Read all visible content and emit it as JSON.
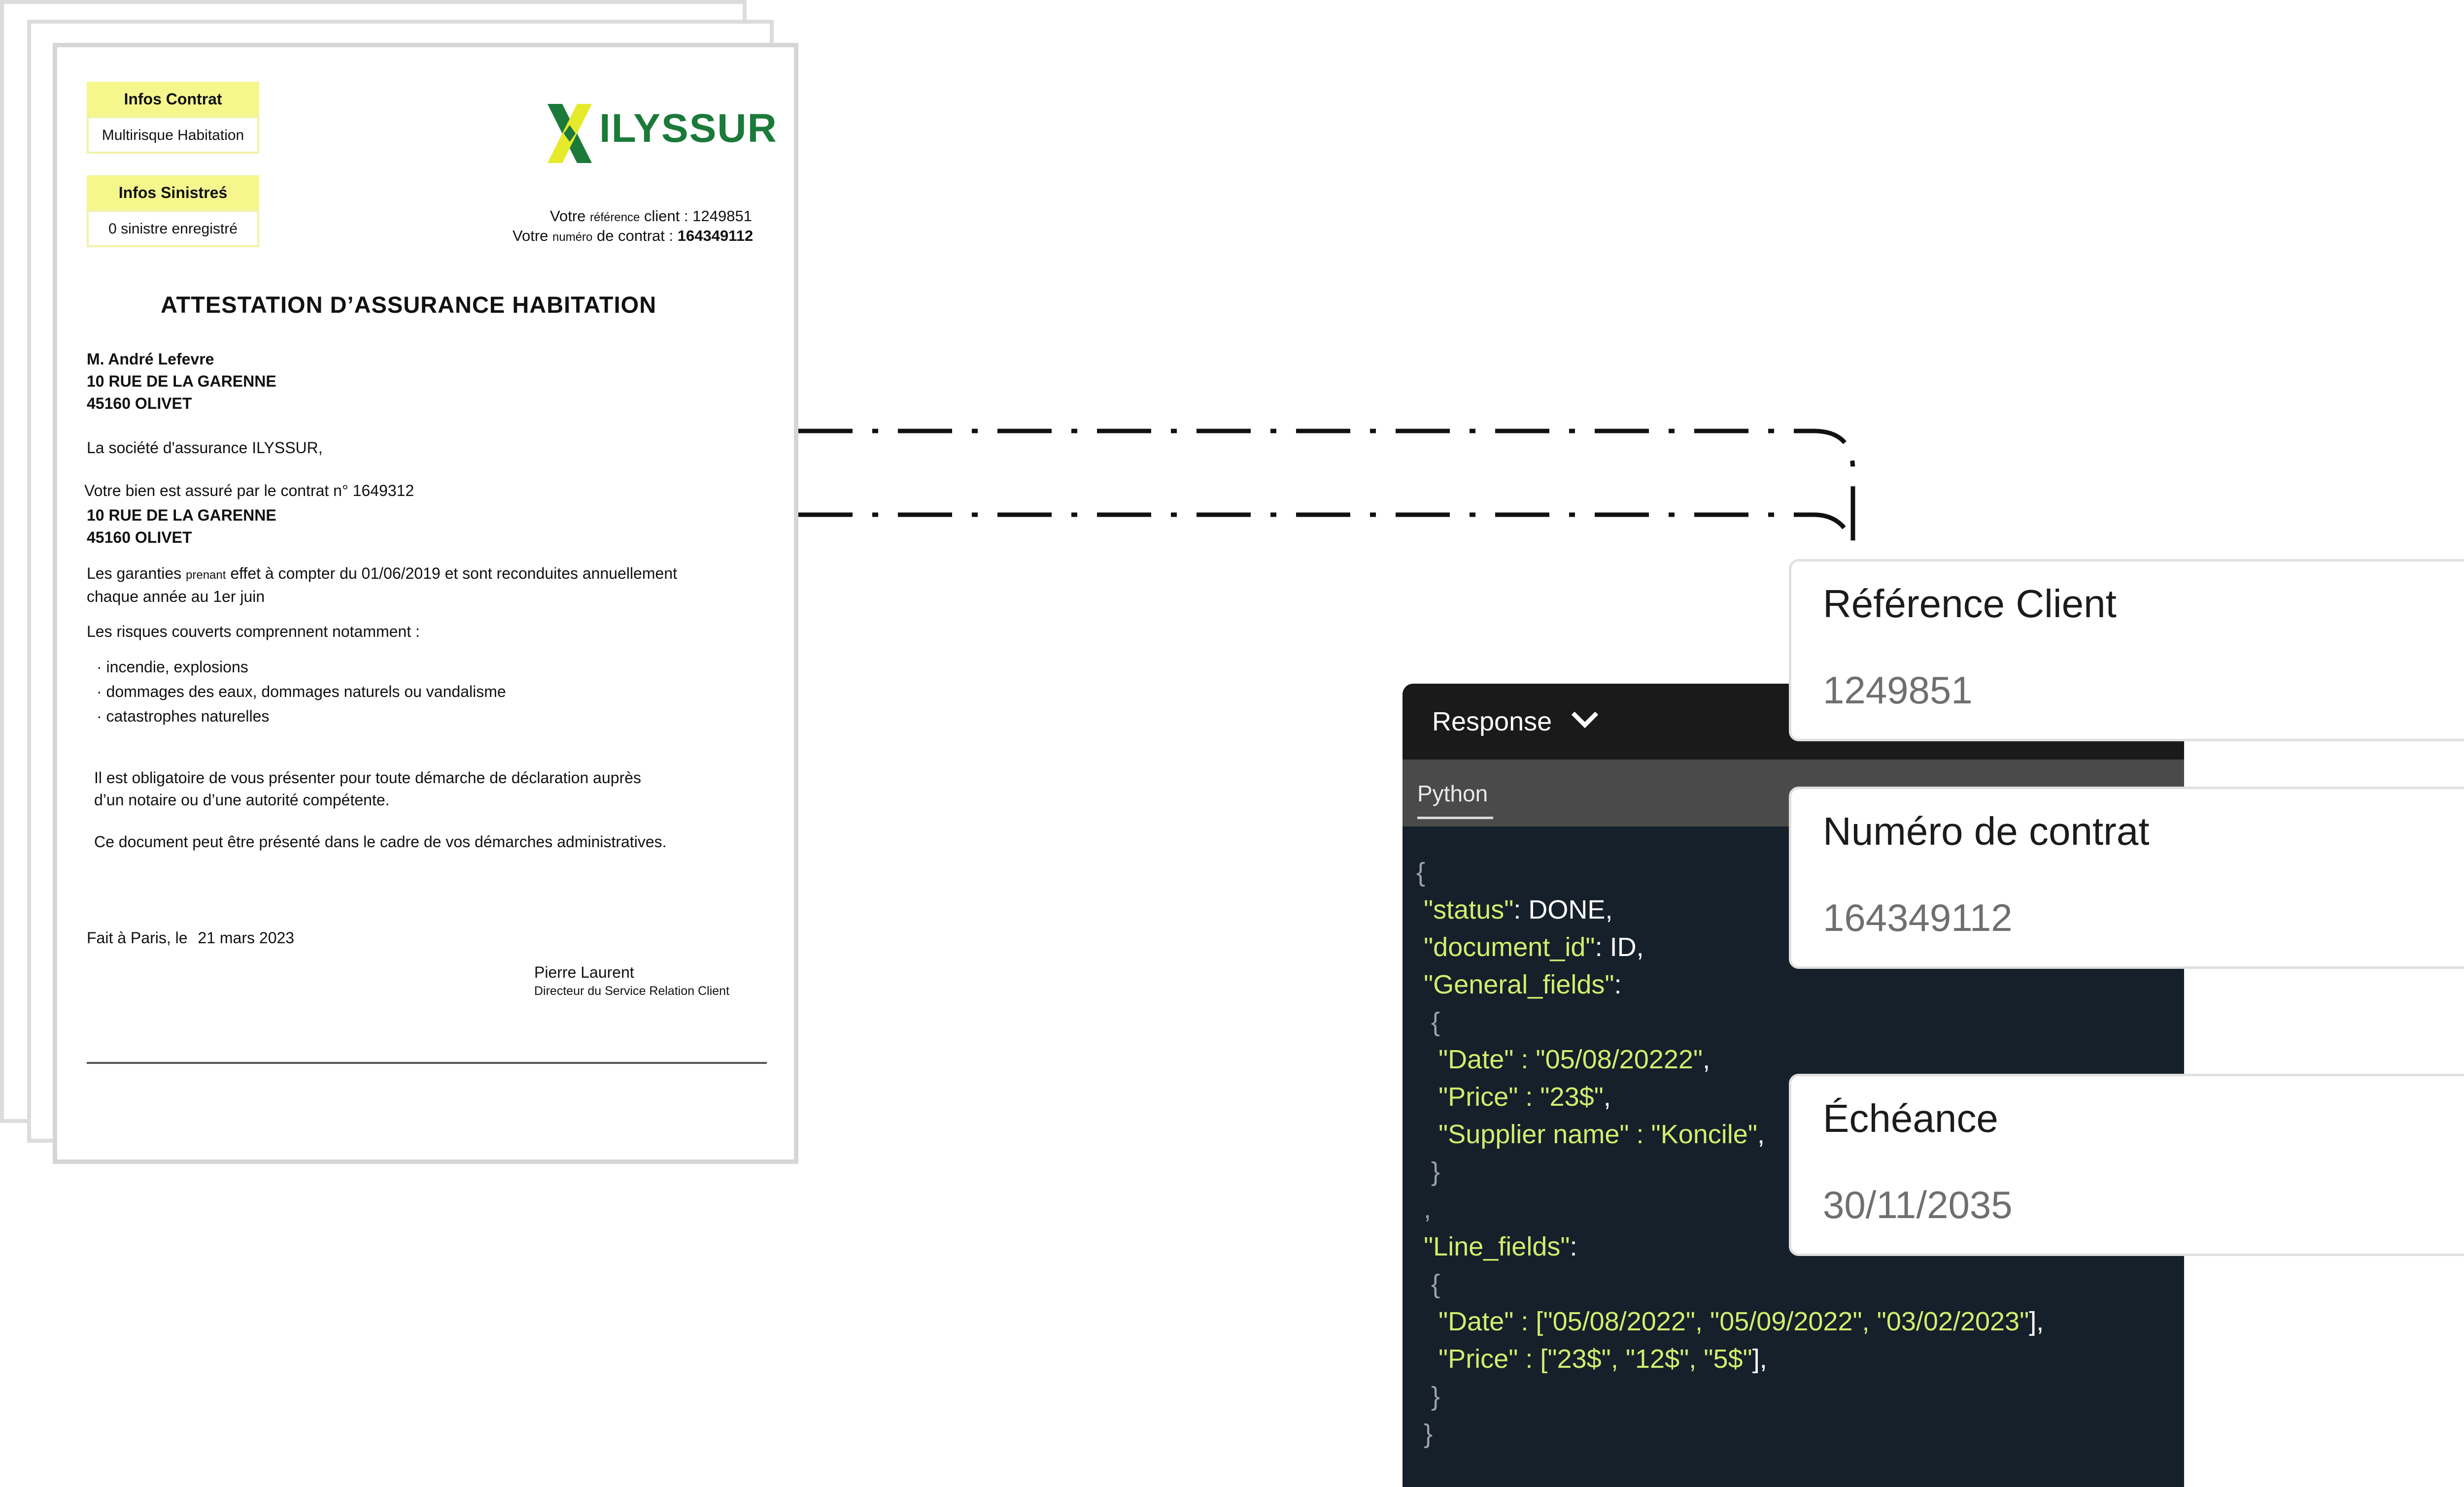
{
  "document": {
    "infos_contrat_label": "Infos Contrat",
    "infos_contrat_value": "Multirisque Habitation",
    "infos_sinistres_label": "Infos Sinistreś",
    "infos_sinistres_value": "0 sinistre enregistré",
    "logo_text": "ILYSSUR",
    "ref_line_prefix": "Votre",
    "ref_line_word": "référence",
    "ref_line_suffix": "client : 1249851",
    "contract_line_prefix": "Votre",
    "contract_line_word": "numéro",
    "contract_line_mid": "de contrat :",
    "contract_line_number": "164349112",
    "title": "ATTESTATION D’ASSURANCE HABITATION",
    "addr1": [
      "M. André Lefevre",
      "10 RUE DE LA GARENNE",
      "45160 OLIVET"
    ],
    "company_line": "La société d'assurance ILYSSUR,",
    "contract_sentence": "Votre bien est assuré par le contrat n° 1649312",
    "addr2": [
      "10 RUE DE LA GARENNE",
      "45160 OLIVET"
    ],
    "guarantees_line1_a": "Les garanties",
    "guarantees_line1_b": "prenant",
    "guarantees_line1_c": "effet à compter du 01/06/2019 et sont reconduites annuellement",
    "guarantees_line2": "chaque année au 1er juin",
    "risks_intro": "Les risques couverts comprennent notamment :",
    "risks": [
      "incendie, explosions",
      "dommages des eaux, dommages naturels ou vandalisme",
      "catastrophes naturelles"
    ],
    "obligation_line1": "Il est obligatoire de vous présenter pour toute démarche de déclaration auprès",
    "obligation_line2": "d’un notaire ou d’une autorité compétente.",
    "usage_line": "Ce document peut être présenté dans le cadre de vos démarches administratives.",
    "place_date_a": "Fait à Paris, le",
    "place_date_b": "21 mars 2023",
    "signer_name": "Pierre Laurent",
    "signer_title": "Directeur du Service Relation Client"
  },
  "response": {
    "title": "Response",
    "tab": "Python",
    "code_lines": [
      [
        {
          "t": "{",
          "c": "g"
        }
      ],
      [
        {
          "t": " \"status\"",
          "c": "y"
        },
        {
          "t": ": DONE,",
          "c": "w"
        }
      ],
      [
        {
          "t": " \"document_id\"",
          "c": "y"
        },
        {
          "t": ": ID,",
          "c": "w"
        }
      ],
      [
        {
          "t": " \"General_fields\"",
          "c": "y"
        },
        {
          "t": ":",
          "c": "w"
        }
      ],
      [
        {
          "t": "  {",
          "c": "g"
        }
      ],
      [
        {
          "t": "   \"Date\" : \"05/08/20222\"",
          "c": "y"
        },
        {
          "t": ",",
          "c": "w"
        }
      ],
      [
        {
          "t": "   \"Price\" : \"23$\"",
          "c": "y"
        },
        {
          "t": ",",
          "c": "w"
        }
      ],
      [
        {
          "t": "   \"Supplier name\" : \"Koncile\"",
          "c": "y"
        },
        {
          "t": ",",
          "c": "w"
        }
      ],
      [
        {
          "t": "  }",
          "c": "g"
        }
      ],
      [
        {
          "t": " ,",
          "c": "g"
        }
      ],
      [
        {
          "t": " \"Line_fields\"",
          "c": "y"
        },
        {
          "t": ":",
          "c": "w"
        }
      ],
      [
        {
          "t": "  {",
          "c": "g"
        }
      ],
      [
        {
          "t": "   \"Date\" : [",
          "c": "y"
        },
        {
          "t": "\"05/08/2022\", \"05/09/2022\", \"03/02/2023\"",
          "c": "y"
        },
        {
          "t": "],",
          "c": "w"
        }
      ],
      [
        {
          "t": "   \"Price\" : [",
          "c": "y"
        },
        {
          "t": "\"23$\", \"12$\", \"5$\"",
          "c": "y"
        },
        {
          "t": "],",
          "c": "w"
        }
      ],
      [
        {
          "t": "  }",
          "c": "g"
        }
      ],
      [
        {
          "t": " }",
          "c": "g"
        }
      ]
    ]
  },
  "cards": [
    {
      "label": "Référence Client",
      "value": "1249851"
    },
    {
      "label": "Numéro de contrat",
      "value": "164349112"
    },
    {
      "label": "Échéance",
      "value": "30/11/2035"
    }
  ],
  "colors": {
    "accent_yellow": "#f5f78d",
    "logo_green": "#1b7a3a",
    "logo_yellow": "#e5ea2a",
    "code_key": "#d4ec6e",
    "panel_bg": "#15202b"
  }
}
